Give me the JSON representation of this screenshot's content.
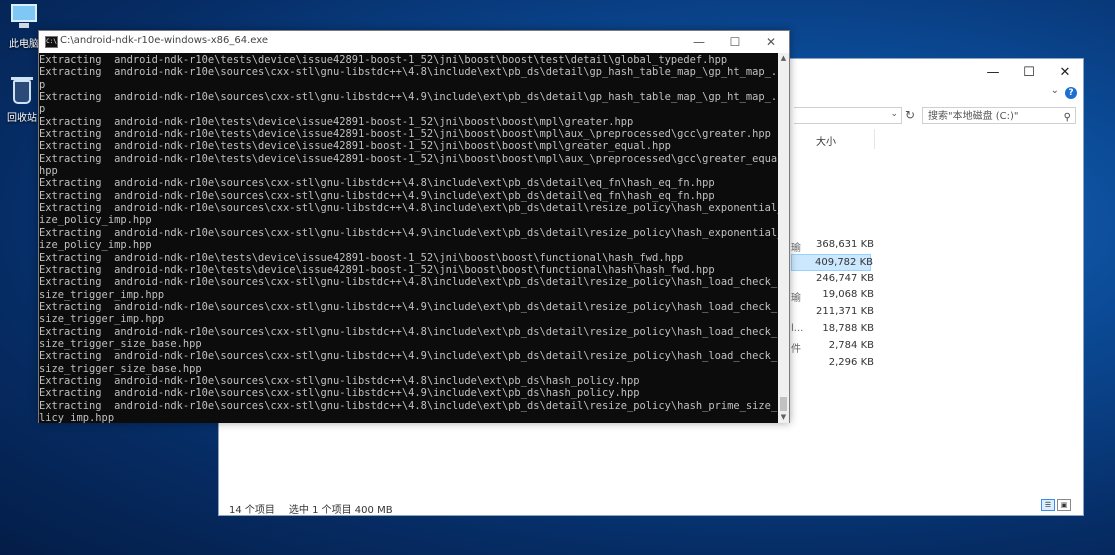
{
  "desktop": {
    "icons": [
      {
        "label": "此电脑",
        "icon": "computer-icon"
      },
      {
        "label": "回收站",
        "icon": "recycle-bin-icon"
      }
    ]
  },
  "console": {
    "title": "C:\\android-ndk-r10e-windows-x86_64.exe",
    "icon": "console-icon",
    "lines": [
      "Extracting  android-ndk-r10e\\tests\\device\\issue42891-boost-1_52\\jni\\boost\\boost\\test\\detail\\global_typedef.hpp",
      "Extracting  android-ndk-r10e\\sources\\cxx-stl\\gnu-libstdc++\\4.8\\include\\ext\\pb_ds\\detail\\gp_hash_table_map_\\gp_ht_map_.hp",
      "p",
      "Extracting  android-ndk-r10e\\sources\\cxx-stl\\gnu-libstdc++\\4.9\\include\\ext\\pb_ds\\detail\\gp_hash_table_map_\\gp_ht_map_.hp",
      "p",
      "Extracting  android-ndk-r10e\\tests\\device\\issue42891-boost-1_52\\jni\\boost\\boost\\mpl\\greater.hpp",
      "Extracting  android-ndk-r10e\\tests\\device\\issue42891-boost-1_52\\jni\\boost\\boost\\mpl\\aux_\\preprocessed\\gcc\\greater.hpp",
      "Extracting  android-ndk-r10e\\tests\\device\\issue42891-boost-1_52\\jni\\boost\\boost\\mpl\\greater_equal.hpp",
      "Extracting  android-ndk-r10e\\tests\\device\\issue42891-boost-1_52\\jni\\boost\\boost\\mpl\\aux_\\preprocessed\\gcc\\greater_equal.",
      "hpp",
      "Extracting  android-ndk-r10e\\sources\\cxx-stl\\gnu-libstdc++\\4.8\\include\\ext\\pb_ds\\detail\\eq_fn\\hash_eq_fn.hpp",
      "Extracting  android-ndk-r10e\\sources\\cxx-stl\\gnu-libstdc++\\4.9\\include\\ext\\pb_ds\\detail\\eq_fn\\hash_eq_fn.hpp",
      "Extracting  android-ndk-r10e\\sources\\cxx-stl\\gnu-libstdc++\\4.8\\include\\ext\\pb_ds\\detail\\resize_policy\\hash_exponential_s",
      "ize_policy_imp.hpp",
      "Extracting  android-ndk-r10e\\sources\\cxx-stl\\gnu-libstdc++\\4.9\\include\\ext\\pb_ds\\detail\\resize_policy\\hash_exponential_s",
      "ize_policy_imp.hpp",
      "Extracting  android-ndk-r10e\\tests\\device\\issue42891-boost-1_52\\jni\\boost\\boost\\functional\\hash_fwd.hpp",
      "Extracting  android-ndk-r10e\\tests\\device\\issue42891-boost-1_52\\jni\\boost\\boost\\functional\\hash\\hash_fwd.hpp",
      "Extracting  android-ndk-r10e\\sources\\cxx-stl\\gnu-libstdc++\\4.8\\include\\ext\\pb_ds\\detail\\resize_policy\\hash_load_check_re",
      "size_trigger_imp.hpp",
      "Extracting  android-ndk-r10e\\sources\\cxx-stl\\gnu-libstdc++\\4.9\\include\\ext\\pb_ds\\detail\\resize_policy\\hash_load_check_re",
      "size_trigger_imp.hpp",
      "Extracting  android-ndk-r10e\\sources\\cxx-stl\\gnu-libstdc++\\4.8\\include\\ext\\pb_ds\\detail\\resize_policy\\hash_load_check_re",
      "size_trigger_size_base.hpp",
      "Extracting  android-ndk-r10e\\sources\\cxx-stl\\gnu-libstdc++\\4.9\\include\\ext\\pb_ds\\detail\\resize_policy\\hash_load_check_re",
      "size_trigger_size_base.hpp",
      "Extracting  android-ndk-r10e\\sources\\cxx-stl\\gnu-libstdc++\\4.8\\include\\ext\\pb_ds\\hash_policy.hpp",
      "Extracting  android-ndk-r10e\\sources\\cxx-stl\\gnu-libstdc++\\4.9\\include\\ext\\pb_ds\\hash_policy.hpp",
      "Extracting  android-ndk-r10e\\sources\\cxx-stl\\gnu-libstdc++\\4.8\\include\\ext\\pb_ds\\detail\\resize_policy\\hash_prime_size_po",
      "licy_imp.hpp"
    ]
  },
  "explorer": {
    "search_placeholder": "搜索\"本地磁盘 (C:)\"",
    "size_column": "大小",
    "rows": [
      {
        "frag": "瑜",
        "size": "368,631 KB",
        "selected": false
      },
      {
        "frag": "",
        "size": "409,782 KB",
        "selected": true
      },
      {
        "frag": "",
        "size": "246,747 KB",
        "selected": false
      },
      {
        "frag": "瑜",
        "size": "19,068 KB",
        "selected": false
      },
      {
        "frag": "",
        "size": "211,371 KB",
        "selected": false
      },
      {
        "frag": "l...",
        "size": "18,788 KB",
        "selected": false
      },
      {
        "frag": "件",
        "size": "2,784 KB",
        "selected": false
      },
      {
        "frag": "",
        "size": "2,296 KB",
        "selected": false
      }
    ],
    "status": {
      "count": "14 个项目",
      "selection": "选中 1 个项目  400 MB"
    }
  }
}
